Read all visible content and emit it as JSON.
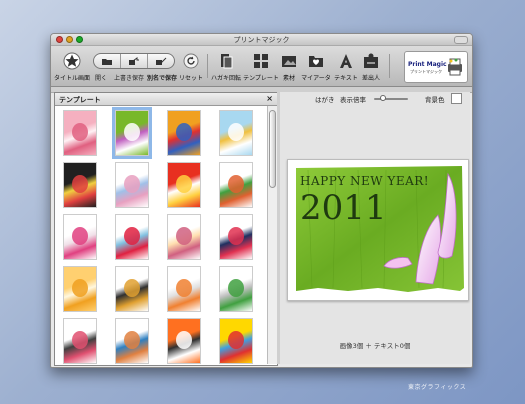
{
  "window": {
    "title": "プリントマジック"
  },
  "toolbar": {
    "items": [
      {
        "label": "タイトル画面",
        "icon": "home-star-icon"
      },
      {
        "label": "開く",
        "icon": "open-icon"
      },
      {
        "label": "上書き保存",
        "icon": "save-icon"
      },
      {
        "label": "別名で保存",
        "icon": "save-as-icon"
      },
      {
        "label": "リセット",
        "icon": "reset-icon"
      },
      {
        "label": "ハガキ回転",
        "icon": "rotate-card-icon"
      },
      {
        "label": "テンプレート",
        "icon": "template-icon"
      },
      {
        "label": "素材",
        "icon": "material-icon"
      },
      {
        "label": "マイアータ",
        "icon": "my-data-icon"
      },
      {
        "label": "テキスト",
        "icon": "text-icon"
      },
      {
        "label": "差出人",
        "icon": "sender-icon"
      }
    ],
    "logo": {
      "line1": "Print Magic",
      "line2": "プリントマジック"
    }
  },
  "template_panel": {
    "title": "テンプレート",
    "close": "×",
    "thumbnails": [
      {
        "name": "template-thumb-1",
        "colors": [
          "#f5b0c0",
          "#e06080",
          "#fff2f5"
        ]
      },
      {
        "name": "template-thumb-2",
        "colors": [
          "#78b82a",
          "#ffffff",
          "#c060c0"
        ],
        "selected": true
      },
      {
        "name": "template-thumb-3",
        "colors": [
          "#f0a020",
          "#3060c0",
          "#e03030"
        ]
      },
      {
        "name": "template-thumb-4",
        "colors": [
          "#a8d8f0",
          "#ffffff",
          "#f0c040"
        ]
      },
      {
        "name": "template-thumb-5",
        "colors": [
          "#202020",
          "#e04040",
          "#f0d040"
        ]
      },
      {
        "name": "template-thumb-6",
        "colors": [
          "#ffffff",
          "#e8a0c0",
          "#a0c0e8"
        ]
      },
      {
        "name": "template-thumb-7",
        "colors": [
          "#e83020",
          "#ffd040",
          "#ffffff"
        ]
      },
      {
        "name": "template-thumb-8",
        "colors": [
          "#ffffff",
          "#e06030",
          "#40a040"
        ]
      },
      {
        "name": "template-thumb-9",
        "colors": [
          "#ffffff",
          "#e04080",
          "#f0e0e8"
        ]
      },
      {
        "name": "template-thumb-10",
        "colors": [
          "#ffffff",
          "#e02040",
          "#80c0e0"
        ]
      },
      {
        "name": "template-thumb-11",
        "colors": [
          "#ffffff",
          "#d06080",
          "#ffe0b0"
        ]
      },
      {
        "name": "template-thumb-12",
        "colors": [
          "#ffffff",
          "#e03050",
          "#203060"
        ]
      },
      {
        "name": "template-thumb-13",
        "colors": [
          "#ffd070",
          "#f0a020",
          "#fff8e0"
        ]
      },
      {
        "name": "template-thumb-14",
        "colors": [
          "#ffffff",
          "#e0a030",
          "#303030"
        ]
      },
      {
        "name": "template-thumb-15",
        "colors": [
          "#ffffff",
          "#f08030",
          "#e0e0e0"
        ]
      },
      {
        "name": "template-thumb-16",
        "colors": [
          "#ffffff",
          "#40a040",
          "#c0c0c0"
        ]
      },
      {
        "name": "template-thumb-17",
        "colors": [
          "#ffffff",
          "#e05070",
          "#404040"
        ]
      },
      {
        "name": "template-thumb-18",
        "colors": [
          "#ffffff",
          "#e08040",
          "#3080c0"
        ]
      },
      {
        "name": "template-thumb-19",
        "colors": [
          "#ff7020",
          "#ffffff",
          "#303030"
        ]
      },
      {
        "name": "template-thumb-20",
        "colors": [
          "#ffd800",
          "#e03030",
          "#40a0e0"
        ]
      }
    ]
  },
  "preview": {
    "card_size_label": "はがき",
    "zoom_label": "表示倍率",
    "zoom_level": 0.2,
    "bg_label": "背景色",
    "bg_color": "#ffffff",
    "card_text_line1": "HAPPY NEW YEAR!",
    "card_text_line2": "2011",
    "card_bg": "#7cbc2a",
    "status": "画像3個 ＋ テキスト0個"
  },
  "watermark": "東京グラフィックス"
}
